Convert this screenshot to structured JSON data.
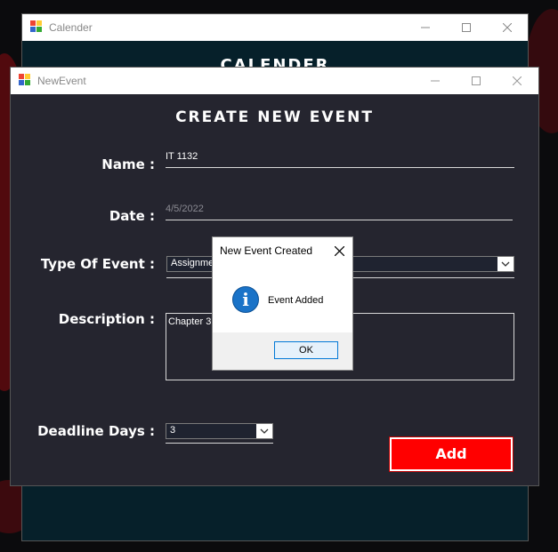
{
  "calender_window": {
    "title": "Calender",
    "heading": "CALENDER"
  },
  "newevent_window": {
    "title": "NewEvent",
    "heading": "CREATE NEW EVENT",
    "form": {
      "name_label": "Name :",
      "name_value": "IT 1132",
      "date_label": "Date :",
      "date_value": "4/5/2022",
      "type_label": "Type Of Event :",
      "type_value": "Assignmen",
      "description_label": "Description :",
      "description_value": "Chapter 3",
      "deadline_label": "Deadline Days :",
      "deadline_value": "3",
      "add_label": "Add"
    }
  },
  "message_box": {
    "title": "New Event Created",
    "message": "Event Added",
    "ok_label": "OK"
  },
  "icons": {
    "window": "app-icon",
    "minimize": "minimize-icon",
    "maximize": "maximize-icon",
    "close": "close-icon",
    "dropdown": "chevron-down-icon",
    "info": "info-icon"
  },
  "colors": {
    "form_bg": "#25252f",
    "calender_bg": "#06202a",
    "add_button": "#ff0000",
    "info_blue": "#1a73c8",
    "ok_border": "#0078d7"
  }
}
